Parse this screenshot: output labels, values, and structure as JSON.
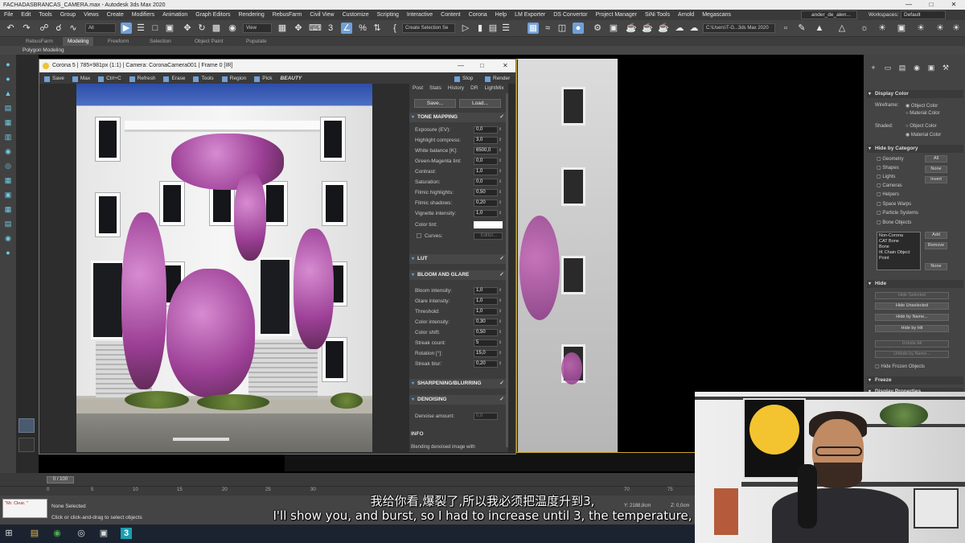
{
  "window": {
    "title": "FACHADASBRANCAS_CAMERA.max - Autodesk 3ds Max 2020"
  },
  "menu": [
    "File",
    "Edit",
    "Tools",
    "Group",
    "Views",
    "Create",
    "Modifiers",
    "Animation",
    "Graph Editors",
    "Rendering",
    "RebusFarm",
    "Civil View",
    "Customize",
    "Scripting",
    "Interactive",
    "Content",
    "Corona",
    "Help",
    "LM Exporter",
    "DS Convertor",
    "Project Manager",
    "SiNi Tools",
    "Arnold",
    "Megascans"
  ],
  "user": {
    "name": "ander_de_alen..."
  },
  "workspace": {
    "label": "Workspaces:",
    "value": "Default"
  },
  "toolbar": {
    "filter_all": "All",
    "view_dropdown": "View",
    "selection_set": "Create Selection Se",
    "path": "C:\\Users\\T-G...3ds Max 2020"
  },
  "ribbon": {
    "tabs": [
      "RebusFarm",
      "Modeling",
      "Freeform",
      "Selection",
      "Object Paint",
      "Populate"
    ],
    "active": "Modeling",
    "subtab": "Polygon Modeling"
  },
  "vfb": {
    "title": "Corona 5 | 785×981px (1:1) | Camera: CoronaCamera001 | Frame 0 [IR]",
    "toolbar": [
      "Save",
      "Max",
      "Ctrl+C",
      "Refresh",
      "Erase",
      "Tools",
      "Region",
      "Pick"
    ],
    "channel": "BEAUTY",
    "right_toolbar": [
      "Stop",
      "Render"
    ],
    "tabs": [
      "Post",
      "Stats",
      "History",
      "DR",
      "LightMix"
    ],
    "save_btn": "Save...",
    "load_btn": "Load...",
    "sections": {
      "tone_mapping": "TONE MAPPING",
      "lut": "LUT",
      "bloom": "BLOOM AND GLARE",
      "sharpen": "SHARPENING/BLURRING",
      "denoise": "DENOISING",
      "info": "INFO"
    },
    "tone_params": [
      {
        "label": "Exposure (EV):",
        "value": "0,0"
      },
      {
        "label": "Highlight compress:",
        "value": "3,0"
      },
      {
        "label": "White balance [K]:",
        "value": "6500,0"
      },
      {
        "label": "Green-Magenta tint:",
        "value": "0,0"
      },
      {
        "label": "Contrast:",
        "value": "1,0"
      },
      {
        "label": "Saturation:",
        "value": "0,0"
      },
      {
        "label": "Filmic highlights:",
        "value": "0,50"
      },
      {
        "label": "Filmic shadows:",
        "value": "0,20"
      },
      {
        "label": "Vignette intensity:",
        "value": "1,0"
      }
    ],
    "color_tint": "Color tint:",
    "curves": "Curves:",
    "curves_btn": "Editor...",
    "bloom_params": [
      {
        "label": "Bloom intensity:",
        "value": "1,0"
      },
      {
        "label": "Glare intensity:",
        "value": "1,0"
      },
      {
        "label": "Threshold:",
        "value": "1,0"
      },
      {
        "label": "Color intensity:",
        "value": "0,30"
      },
      {
        "label": "Color shift:",
        "value": "0,50"
      },
      {
        "label": "Streak count:",
        "value": "5"
      },
      {
        "label": "Rotation [°]:",
        "value": "15,0"
      },
      {
        "label": "Streak blur:",
        "value": "0,20"
      }
    ],
    "denoise_label": "Denoise amount:",
    "denoise_value": "0,0",
    "info_text": "Blending denoised image with"
  },
  "command_panel": {
    "display_color": "Display Color",
    "wireframe": "Wireframe:",
    "shaded": "Shaded:",
    "object_color": "Object Color",
    "material_color": "Material Color",
    "hide_by_category": "Hide by Category",
    "categories": [
      "Geometry",
      "Shapes",
      "Lights",
      "Cameras",
      "Helpers",
      "Space Warps",
      "Particle Systems",
      "Bone Objects"
    ],
    "cat_buttons": [
      "All",
      "None",
      "Invert"
    ],
    "list_items": [
      "Non-Corona",
      "CAT Bone",
      "Bone",
      "IK Chain Object",
      "Point"
    ],
    "list_buttons": [
      "Add",
      "Remove",
      "None"
    ],
    "hide": "Hide",
    "hide_buttons": [
      "Hide Selected",
      "Hide Unselected",
      "Hide by Name...",
      "Hide by Hit",
      "Unhide All",
      "Unhide by Name..."
    ],
    "hide_frozen": "Hide Frozen Objects",
    "freeze": "Freeze",
    "display_props": "Display Properties"
  },
  "timeline": {
    "slider": "0 / 100",
    "ticks": [
      "0",
      "5",
      "10",
      "15",
      "20",
      "25",
      "30",
      "70",
      "75"
    ]
  },
  "status": {
    "maxscript": "\"Mr. Clear. \"",
    "selection": "None Selected",
    "prompt": "Click or click-and-drag to select objects",
    "y_coord": "Y: 2188,8cm",
    "z_coord": "Z: 0,0cm"
  },
  "subtitles": {
    "cn": "我给你看,爆裂了,所以我必须把温度升到3,",
    "en": "I'll show you, and burst, so I had to increase until 3, the temperature,"
  },
  "colors": {
    "accent": "#6fa0d8",
    "active_viewport": "#c9a72c",
    "flowers": "#b25aa8"
  }
}
